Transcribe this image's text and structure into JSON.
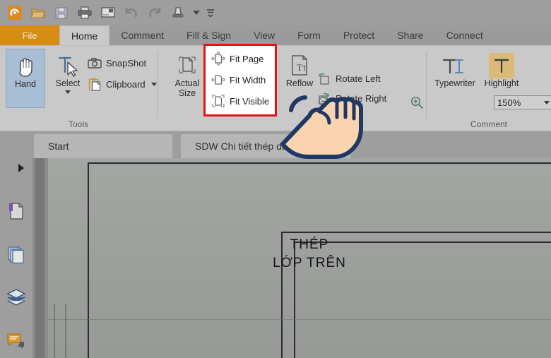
{
  "quick_access": {
    "items": [
      {
        "name": "app-logo-icon",
        "label": "Foxit"
      },
      {
        "name": "open-icon",
        "label": "Open"
      },
      {
        "name": "save-icon",
        "label": "Save"
      },
      {
        "name": "print-icon",
        "label": "Print"
      },
      {
        "name": "email-icon",
        "label": "Email"
      },
      {
        "name": "undo-icon",
        "label": "Undo"
      },
      {
        "name": "redo-icon",
        "label": "Redo"
      },
      {
        "name": "sign-stamp-icon",
        "label": "Sign"
      },
      {
        "name": "customize-toolbar-icon",
        "label": "Customize"
      }
    ]
  },
  "ribbon": {
    "tabs": [
      {
        "label": "File",
        "active": false,
        "style": "file"
      },
      {
        "label": "Home",
        "active": true
      },
      {
        "label": "Comment",
        "active": false
      },
      {
        "label": "Fill & Sign",
        "active": false
      },
      {
        "label": "View",
        "active": false
      },
      {
        "label": "Form",
        "active": false
      },
      {
        "label": "Protect",
        "active": false
      },
      {
        "label": "Share",
        "active": false
      },
      {
        "label": "Connect",
        "active": false
      }
    ],
    "groups": {
      "tools": {
        "label": "Tools",
        "hand": "Hand",
        "select": "Select",
        "snapshot": "SnapShot",
        "clipboard": "Clipboard"
      },
      "view": {
        "actual_size_line1": "Actual",
        "actual_size_line2": "Size",
        "reflow": "Reflow",
        "rotate_left": "Rotate Left",
        "rotate_right": "Rotate Right",
        "zoom_value": "150%",
        "fit_menu": {
          "highlighted": true,
          "highlight_color": "#e8130f",
          "items": [
            {
              "label": "Fit Page",
              "icon": "fit-page-icon"
            },
            {
              "label": "Fit Width",
              "icon": "fit-width-icon"
            },
            {
              "label": "Fit Visible",
              "icon": "fit-visible-icon"
            }
          ]
        }
      },
      "comment": {
        "label": "Comment",
        "typewriter": "Typewriter",
        "highlight": "Highlight",
        "highlight_swatch_color": "#dbb978"
      }
    }
  },
  "document_tabs": [
    {
      "label": "Start",
      "active": false
    },
    {
      "label": "SDW Chi tiết thép dầm ...",
      "active": true
    }
  ],
  "navigation_rail": {
    "expander": "►",
    "items": [
      {
        "name": "bookmarks-icon",
        "label": "Bookmarks",
        "color": "#7a52a0"
      },
      {
        "name": "page-thumbnails-icon",
        "label": "Page Thumbnails",
        "color": "#4a6c96"
      },
      {
        "name": "layers-icon",
        "label": "Layers",
        "color": "#2d4f80"
      },
      {
        "name": "comments-icon",
        "label": "Comments",
        "color": "#d79a2b"
      }
    ]
  },
  "document": {
    "drawing_label_line1": "THÉP",
    "drawing_label_line2": "LỚP TRÊN"
  },
  "cursor": {
    "name": "pointing-hand-cursor",
    "fill": "#fad4ae",
    "outline": "#1f3864"
  }
}
